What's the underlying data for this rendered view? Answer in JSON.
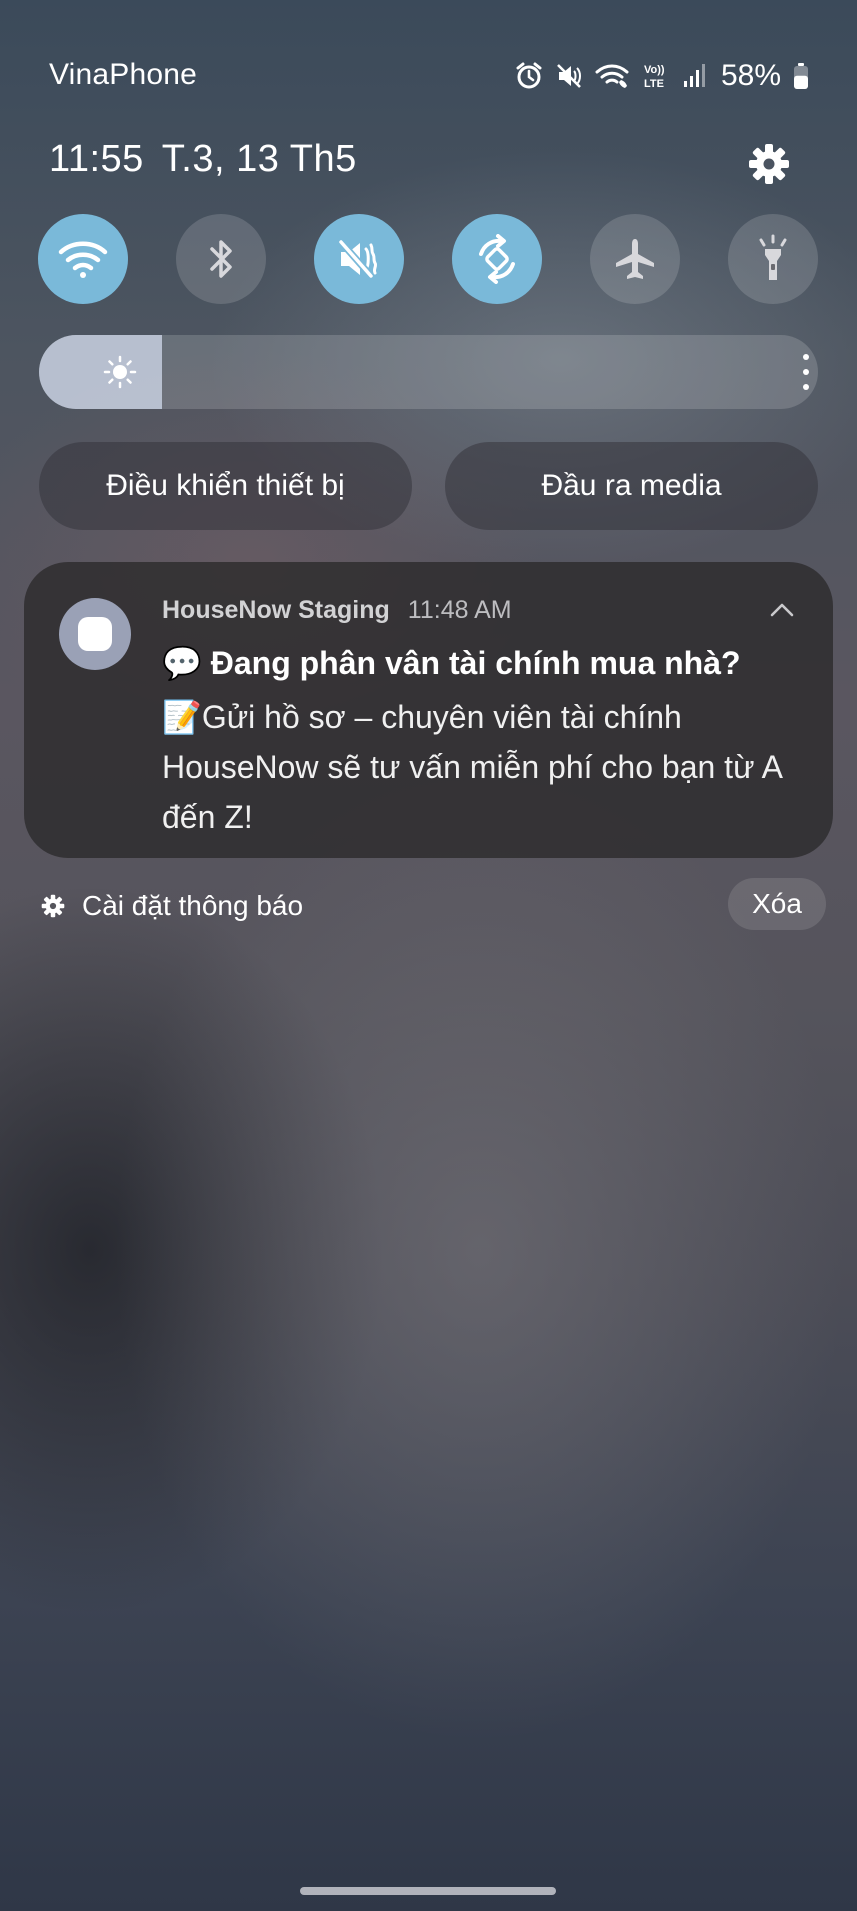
{
  "status_bar": {
    "carrier": "VinaPhone",
    "battery": "58%",
    "battery_level": 0.58,
    "icons": [
      "alarm-icon",
      "mute-icon",
      "wifi-call-icon",
      "volte-icon",
      "signal-icon",
      "battery-icon"
    ],
    "volte_label_top": "Vo))",
    "volte_label_bottom": "LTE"
  },
  "header": {
    "time": "11:55",
    "date": "T.3, 13 Th5"
  },
  "quick_settings": {
    "toggles": [
      {
        "name": "wifi",
        "icon": "wifi-icon",
        "state": "on"
      },
      {
        "name": "bluetooth",
        "icon": "bluetooth-icon",
        "state": "off"
      },
      {
        "name": "sound",
        "icon": "mute-icon",
        "state": "on"
      },
      {
        "name": "auto-rotate",
        "icon": "rotate-icon",
        "state": "on"
      },
      {
        "name": "airplane-mode",
        "icon": "airplane-icon",
        "state": "off"
      },
      {
        "name": "flashlight",
        "icon": "flashlight-icon",
        "state": "off"
      }
    ],
    "brightness_level": 0.158,
    "accent_color": "#7ab9d9",
    "buttons": {
      "device_control": "Điều khiển thiết bị",
      "media_output": "Đầu ra media"
    }
  },
  "notification": {
    "app_name": "HouseNow Staging",
    "time": "11:48 AM",
    "title": "💬 Đang phân vân tài chính mua nhà?",
    "body": "📝Gửi hồ sơ – chuyên viên tài chính HouseNow sẽ tư vấn miễn phí cho bạn từ A đến Z!"
  },
  "footer": {
    "notification_settings": "Cài đặt thông báo",
    "clear": "Xóa"
  }
}
